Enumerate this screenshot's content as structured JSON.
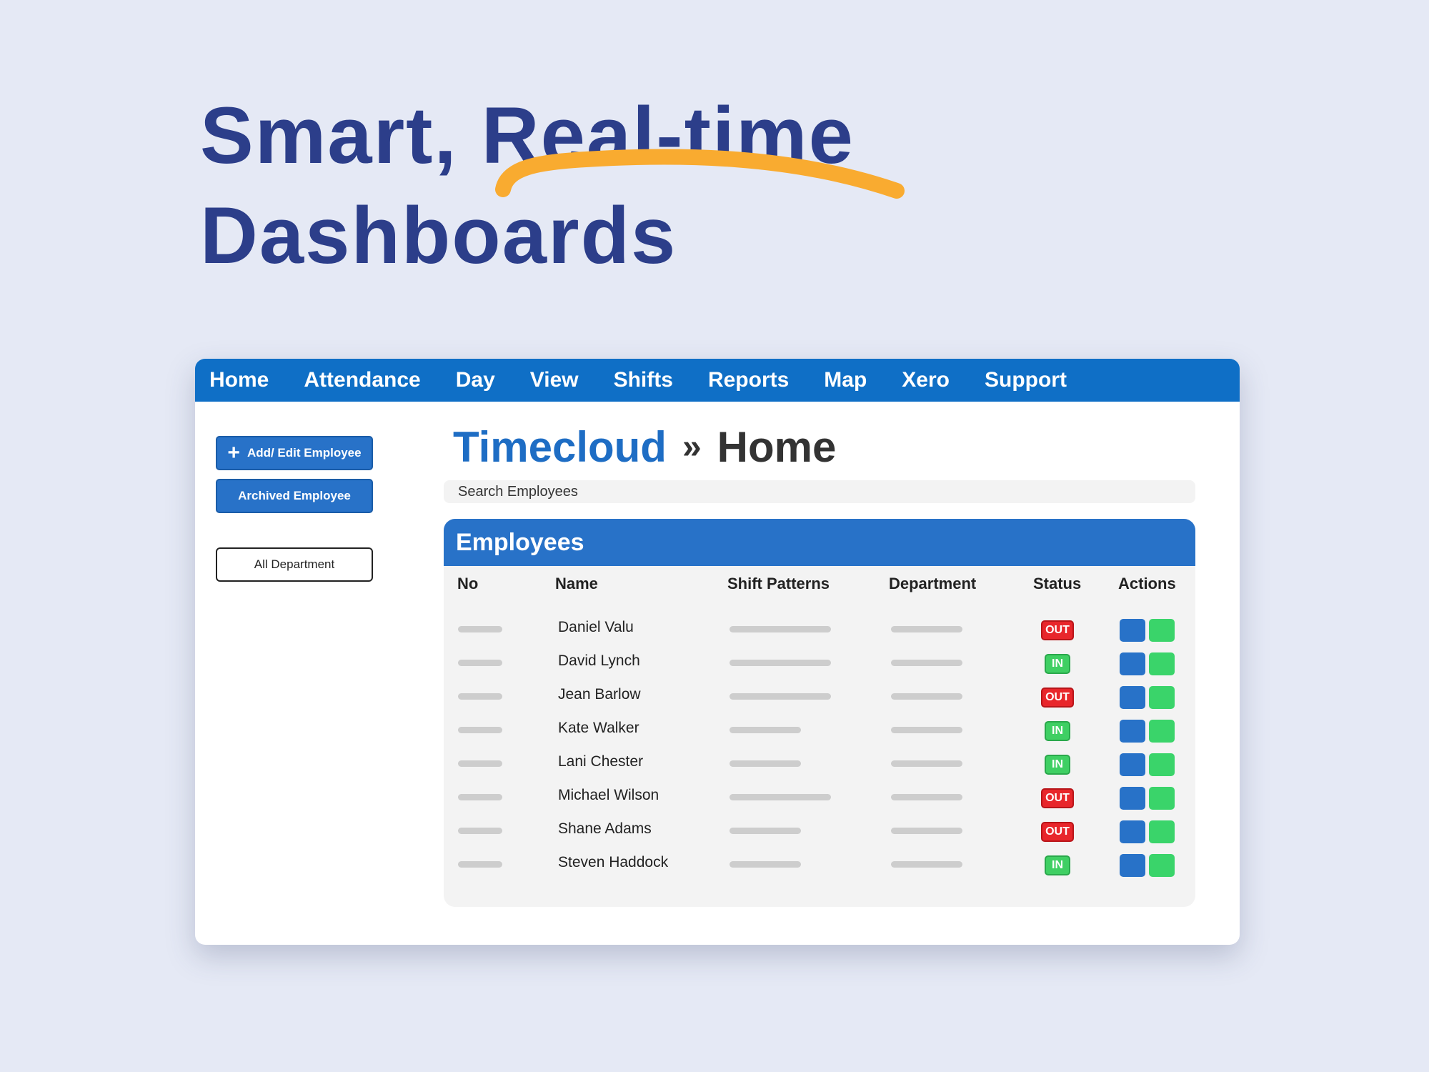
{
  "headline": {
    "line1": "Smart, Real-time",
    "line2": "Dashboards",
    "accent_color": "#f9ab30",
    "text_color": "#2c3e8a"
  },
  "nav": {
    "items": [
      "Home",
      "Attendance",
      "Day",
      "View",
      "Shifts",
      "Reports",
      "Map",
      "Xero",
      "Support"
    ]
  },
  "sidebar": {
    "add_edit_label": "Add/ Edit Employee",
    "add_icon": "plus-icon",
    "archived_label": "Archived Employee",
    "department_label": "All Department"
  },
  "breadcrumb": {
    "brand": "Timecloud",
    "separator": "»",
    "page": "Home"
  },
  "search": {
    "placeholder": "Search Employees"
  },
  "employees": {
    "title": "Employees",
    "columns": [
      "No",
      "Name",
      "Shift Patterns",
      "Department",
      "Status",
      "Actions"
    ],
    "rows": [
      {
        "name": "Daniel Valu",
        "status": "OUT",
        "shift_long": true
      },
      {
        "name": "David Lynch",
        "status": "IN",
        "shift_long": true
      },
      {
        "name": "Jean Barlow",
        "status": "OUT",
        "shift_long": true
      },
      {
        "name": "Kate Walker",
        "status": "IN",
        "shift_long": false
      },
      {
        "name": "Lani Chester",
        "status": "IN",
        "shift_long": false
      },
      {
        "name": "Michael Wilson",
        "status": "OUT",
        "shift_long": true
      },
      {
        "name": "Shane Adams",
        "status": "OUT",
        "shift_long": false
      },
      {
        "name": "Steven Haddock",
        "status": "IN",
        "shift_long": false
      }
    ]
  },
  "colors": {
    "nav_blue": "#0f6fc6",
    "primary_blue": "#2872c8",
    "status_out": "#e8262b",
    "status_in": "#3fcf63",
    "action_green": "#3ad46a"
  }
}
